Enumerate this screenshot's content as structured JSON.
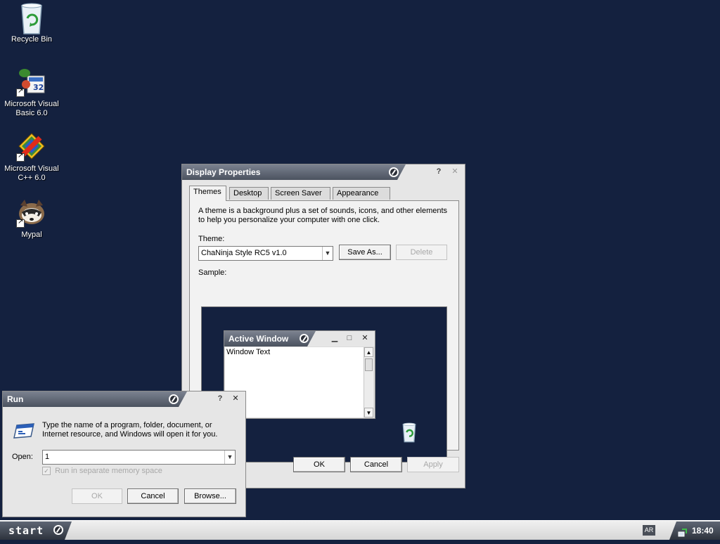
{
  "desktop": {
    "icons": [
      {
        "label_line1": "Recycle Bin",
        "label_line2": ""
      },
      {
        "label_line1": "Microsoft Visual",
        "label_line2": "Basic 6.0"
      },
      {
        "label_line1": "Microsoft Visual",
        "label_line2": "C++ 6.0"
      },
      {
        "label_line1": "Mypal",
        "label_line2": ""
      }
    ]
  },
  "display_properties": {
    "title": "Display Properties",
    "help": "?",
    "close": "✕",
    "tabs": [
      "Themes",
      "Desktop",
      "Screen Saver",
      "Appearance"
    ],
    "active_tab": "Themes",
    "description_line1": "A theme is a background plus a set of sounds, icons, and other elements",
    "description_line2": "to help you personalize your computer with one click.",
    "theme_label": "Theme:",
    "theme_value": "ChaNinja Style RC5 v1.0",
    "save_as": "Save As...",
    "delete": "Delete",
    "sample_label": "Sample:",
    "sample": {
      "window_title": "Active Window",
      "window_text": "Window Text",
      "minimize": "▁",
      "maximize": "□",
      "close": "✕"
    },
    "ok": "OK",
    "cancel": "Cancel",
    "apply": "Apply"
  },
  "run_dialog": {
    "title": "Run",
    "help": "?",
    "close": "✕",
    "description_line1": "Type the name of a program, folder, document, or",
    "description_line2": "Internet resource, and Windows will open it for you.",
    "open_label": "Open:",
    "open_value": "1",
    "checkbox_label": "Run in separate memory space",
    "checkbox_checked": true,
    "ok": "OK",
    "cancel": "Cancel",
    "browse": "Browse..."
  },
  "taskbar": {
    "start_label": "start",
    "language": "AR",
    "clock": "18:40"
  },
  "colors": {
    "desktop_background": "#14213f",
    "titlebar": "#4b525f",
    "window_face": "#e6e6e6"
  }
}
